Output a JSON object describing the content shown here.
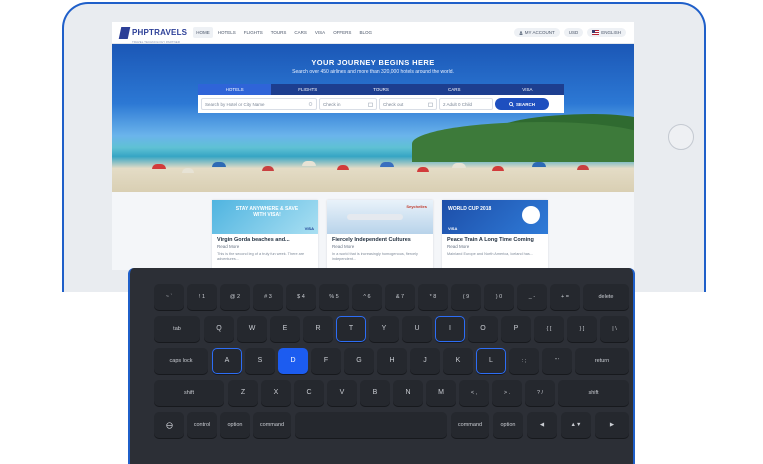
{
  "site": {
    "brand": "PHPTRAVELS",
    "brand_tagline": "TRAVEL TECHNOLOGY PARTNER",
    "nav": [
      "HOME",
      "HOTELS",
      "FLIGHTS",
      "TOURS",
      "CARS",
      "VISA",
      "OFFERS",
      "BLOG"
    ],
    "account": "MY ACCOUNT",
    "currency": "USD",
    "language": "ENGLISH"
  },
  "hero": {
    "title": "YOUR JOURNEY BEGINS HERE",
    "subtitle": "Search over 450 airlines and more than 320,000 hotels around the world."
  },
  "search": {
    "tabs": [
      "HOTELS",
      "FLIGHTS",
      "TOURS",
      "CARS",
      "VISA"
    ],
    "destination_placeholder": "Search by Hotel or City Name",
    "checkin_placeholder": "Check in",
    "checkout_placeholder": "Check out",
    "guests": "2 Adult 0 Child",
    "button": "SEARCH"
  },
  "cards": [
    {
      "image_caption": "STAY ANYWHERE & SAVE WITH VISA!",
      "image_badge": "VISA",
      "title": "Virgin Gorda beaches and...",
      "more": "Read More",
      "text": "This is the second leg of a truly fun week. There are adventures..."
    },
    {
      "image_caption": "",
      "image_badge": "Seychelles",
      "title": "Fiercely Independent Cultures",
      "more": "Read More",
      "text": "In a world that is increasingly homogenous, fiercely independent..."
    },
    {
      "image_caption": "WORLD CUP 2018",
      "image_badge": "VISA",
      "title": "Peace Train A Long Time Coming",
      "more": "Read More",
      "text": "Mainland Europe and North America, Iceland has..."
    }
  ],
  "keyboard": {
    "row1": [
      "~ `",
      "! 1",
      "@ 2",
      "# 3",
      "$ 4",
      "% 5",
      "^ 6",
      "& 7",
      "* 8",
      "( 9",
      ") 0",
      "_ -",
      "+ =",
      "delete"
    ],
    "row2": [
      "tab",
      "Q",
      "W",
      "E",
      "R",
      "T",
      "Y",
      "U",
      "I",
      "O",
      "P",
      "{ [",
      "} ]",
      "| \\"
    ],
    "row3": [
      "caps lock",
      "A",
      "S",
      "D",
      "F",
      "G",
      "H",
      "J",
      "K",
      "L",
      ": ;",
      "\" '",
      "return"
    ],
    "row4": [
      "shift",
      "Z",
      "X",
      "C",
      "V",
      "B",
      "N",
      "M",
      "< ,",
      "> .",
      "? /",
      "shift"
    ],
    "row5": [
      "",
      "control",
      "option",
      "command",
      "",
      "command",
      "option",
      "◀",
      "▲▼",
      "▶"
    ]
  },
  "colors": {
    "accent": "#1c5cf0",
    "brand": "#2c3f97"
  }
}
